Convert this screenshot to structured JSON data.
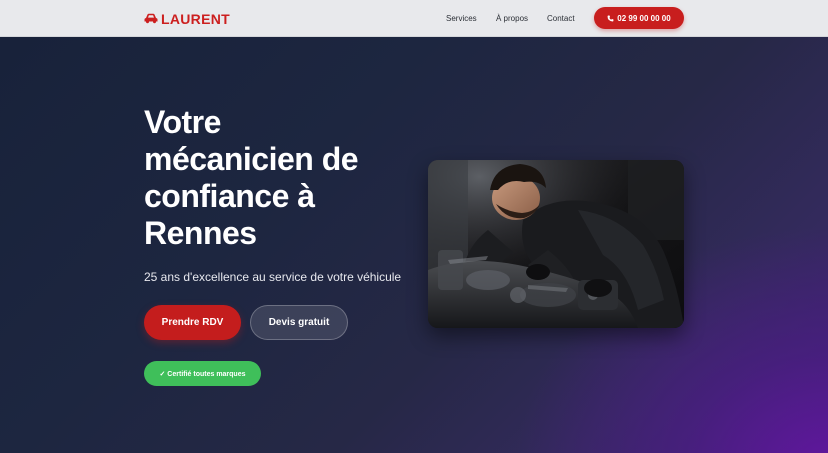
{
  "header": {
    "logo_text": "LAURENT",
    "logo_icon": "car-icon",
    "nav": [
      {
        "label": "Services"
      },
      {
        "label": "À propos"
      },
      {
        "label": "Contact"
      }
    ],
    "phone": {
      "label": "02 99 00 00 00",
      "icon": "phone-icon"
    }
  },
  "hero": {
    "title": "Votre mécanicien de confiance à Rennes",
    "subtitle": "25 ans d'excellence au service de votre véhicule",
    "primary_button": "Prendre RDV",
    "secondary_button": "Devis gratuit",
    "badge": "✓ Certifié toutes marques",
    "image_subject": "mechanic working on car engine"
  },
  "colors": {
    "brand_red": "#c81e1e",
    "badge_green": "#3fbf5a",
    "header_bg": "#e8e9ec",
    "hero_dark": "#1b2338",
    "hero_purple": "#5a1a9a"
  }
}
